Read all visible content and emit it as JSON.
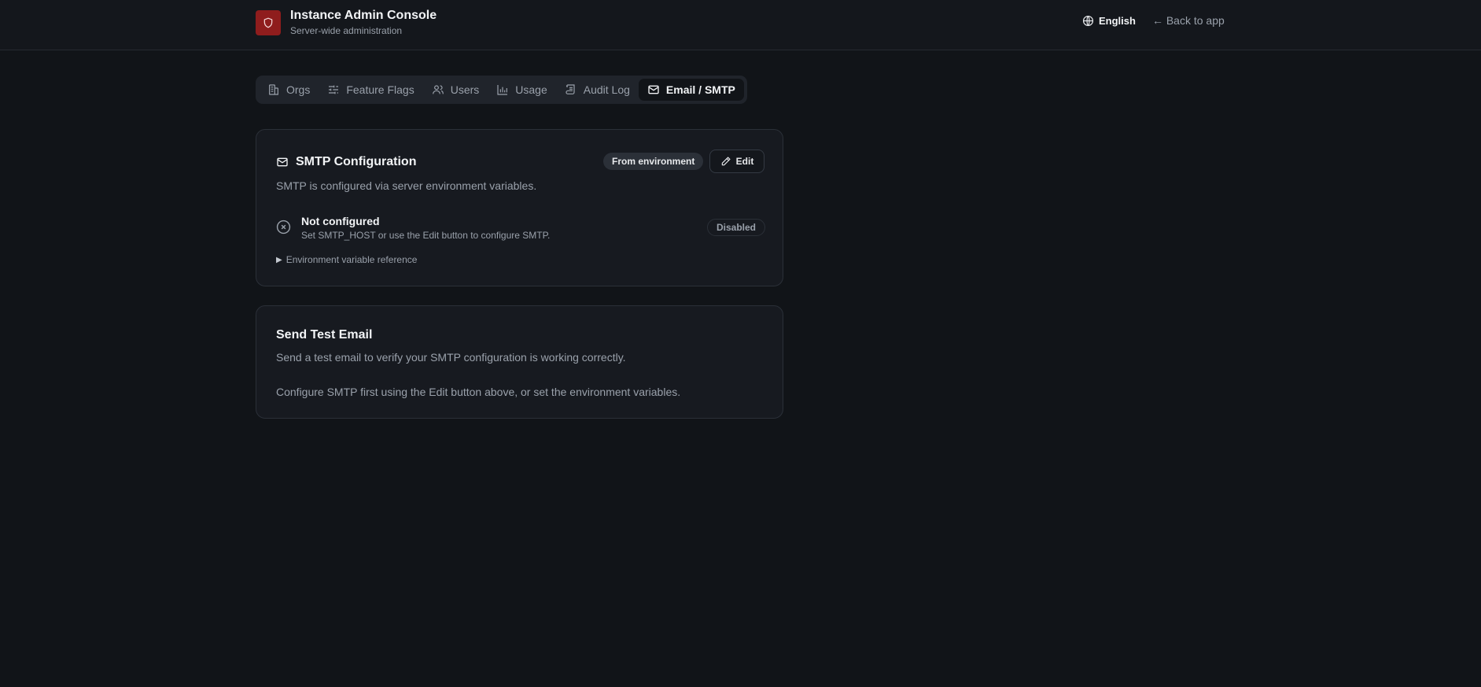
{
  "header": {
    "title": "Instance Admin Console",
    "subtitle": "Server-wide administration",
    "language": "English",
    "back_link": "← Back to app",
    "logo_icon": "shield-icon",
    "brand_color": "#8f1d1d"
  },
  "tabs": [
    {
      "label": "Orgs",
      "icon": "building-icon",
      "active": false
    },
    {
      "label": "Feature Flags",
      "icon": "sliders-icon",
      "active": false
    },
    {
      "label": "Users",
      "icon": "users-icon",
      "active": false
    },
    {
      "label": "Usage",
      "icon": "bar-chart-icon",
      "active": false
    },
    {
      "label": "Audit Log",
      "icon": "scroll-icon",
      "active": false
    },
    {
      "label": "Email / SMTP",
      "icon": "mail-icon",
      "active": true
    }
  ],
  "smtp_card": {
    "title": "SMTP Configuration",
    "source_badge": "From environment",
    "edit_label": "Edit",
    "description": "SMTP is configured via server environment variables.",
    "status_title": "Not configured",
    "status_hint": "Set SMTP_HOST or use the Edit button to configure SMTP.",
    "status_badge": "Disabled",
    "env_reference_label": "Environment variable reference"
  },
  "test_card": {
    "title": "Send Test Email",
    "description": "Send a test email to verify your SMTP configuration is working correctly.",
    "notice": "Configure SMTP first using the Edit button above, or set the environment variables."
  }
}
